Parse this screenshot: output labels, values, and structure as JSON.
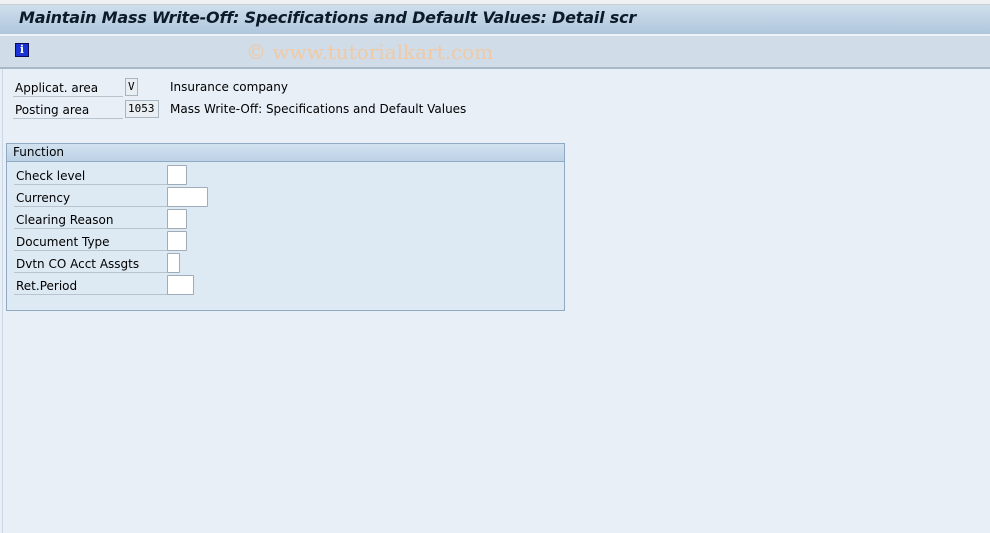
{
  "window": {
    "title": "Maintain Mass Write-Off: Specifications and Default Values: Detail scr",
    "watermark": "© www.tutorialkart.com"
  },
  "toolbar": {
    "info_icon": "info-icon",
    "info_glyph": "i"
  },
  "header_fields": [
    {
      "label": "Applicat. area",
      "value": "V",
      "description": "Insurance company"
    },
    {
      "label": "Posting area",
      "value": "1053",
      "description": "Mass Write-Off: Specifications and Default Values"
    }
  ],
  "function_group": {
    "title": "Function",
    "fields": [
      {
        "label": "Check level",
        "value": ""
      },
      {
        "label": "Currency",
        "value": ""
      },
      {
        "label": "Clearing Reason",
        "value": ""
      },
      {
        "label": "Document Type",
        "value": ""
      },
      {
        "label": "Dvtn CO Acct Assgts",
        "value": ""
      },
      {
        "label": "Ret.Period",
        "value": ""
      }
    ]
  }
}
